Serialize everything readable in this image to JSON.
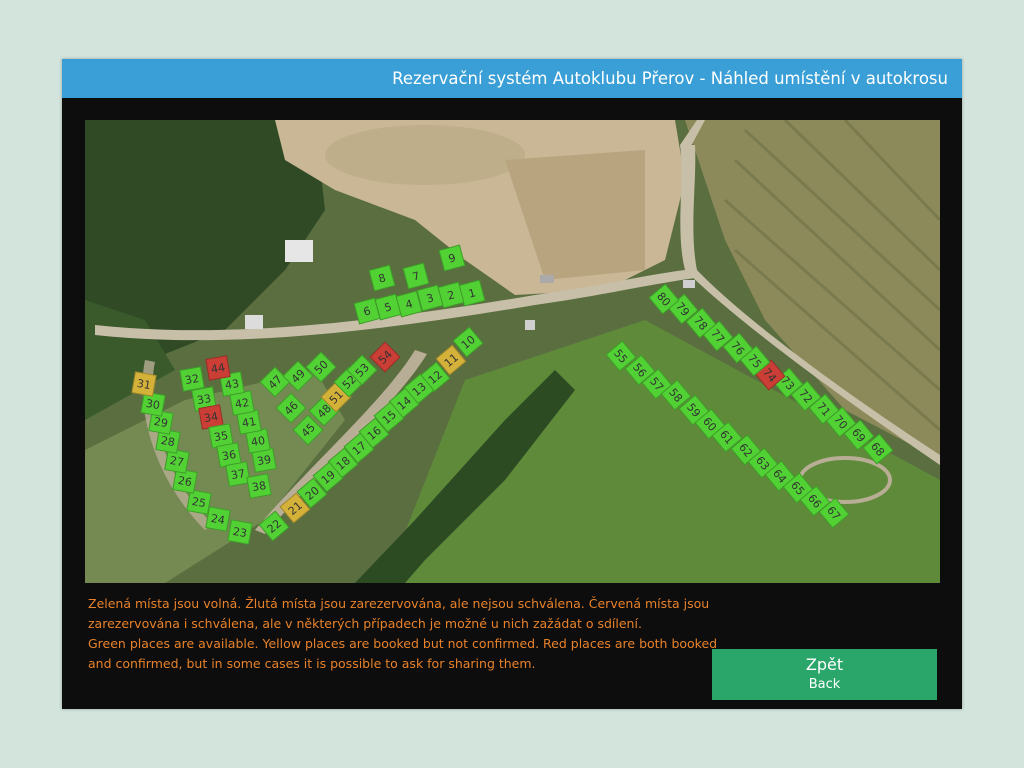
{
  "header": {
    "title": "Rezervační systém Autoklubu Přerov - Náhled umístění v autokrosu"
  },
  "legend": {
    "cs": "Zelená místa jsou volná. Žlutá místa jsou zarezervována, ale nejsou schválena. Červená místa jsou zarezervována i schválena, ale v některých případech je možné u nich zažádat o sdílení.",
    "en": "Green places are available. Yellow places are booked but not confirmed. Red places are both booked and confirmed, but in some cases it is possible to ask for sharing them."
  },
  "back_button": {
    "label_cs": "Zpět",
    "label_en": "Back"
  },
  "status_colors": {
    "free": "#52d135",
    "booked": "#d4b23a",
    "confirmed": "#cb3e35"
  },
  "spots": [
    {
      "label": "1",
      "status": "free"
    },
    {
      "label": "2",
      "status": "free"
    },
    {
      "label": "3",
      "status": "free"
    },
    {
      "label": "4",
      "status": "free"
    },
    {
      "label": "5",
      "status": "free"
    },
    {
      "label": "6",
      "status": "free"
    },
    {
      "label": "7",
      "status": "free"
    },
    {
      "label": "8",
      "status": "free"
    },
    {
      "label": "9",
      "status": "free"
    },
    {
      "label": "10",
      "status": "free"
    },
    {
      "label": "11",
      "status": "booked"
    },
    {
      "label": "12",
      "status": "free"
    },
    {
      "label": "13",
      "status": "free"
    },
    {
      "label": "14",
      "status": "free"
    },
    {
      "label": "15",
      "status": "free"
    },
    {
      "label": "16",
      "status": "free"
    },
    {
      "label": "17",
      "status": "free"
    },
    {
      "label": "18",
      "status": "free"
    },
    {
      "label": "19",
      "status": "free"
    },
    {
      "label": "20",
      "status": "free"
    },
    {
      "label": "21",
      "status": "booked"
    },
    {
      "label": "22",
      "status": "free"
    },
    {
      "label": "23",
      "status": "free"
    },
    {
      "label": "24",
      "status": "free"
    },
    {
      "label": "25",
      "status": "free"
    },
    {
      "label": "26",
      "status": "free"
    },
    {
      "label": "27",
      "status": "free"
    },
    {
      "label": "28",
      "status": "free"
    },
    {
      "label": "29",
      "status": "free"
    },
    {
      "label": "30",
      "status": "free"
    },
    {
      "label": "31",
      "status": "booked"
    },
    {
      "label": "32",
      "status": "free"
    },
    {
      "label": "33",
      "status": "free"
    },
    {
      "label": "34",
      "status": "confirmed"
    },
    {
      "label": "35",
      "status": "free"
    },
    {
      "label": "36",
      "status": "free"
    },
    {
      "label": "37",
      "status": "free"
    },
    {
      "label": "38",
      "status": "free"
    },
    {
      "label": "39",
      "status": "free"
    },
    {
      "label": "40",
      "status": "free"
    },
    {
      "label": "41",
      "status": "free"
    },
    {
      "label": "42",
      "status": "free"
    },
    {
      "label": "43",
      "status": "free"
    },
    {
      "label": "44",
      "status": "confirmed"
    },
    {
      "label": "45",
      "status": "free"
    },
    {
      "label": "46",
      "status": "free"
    },
    {
      "label": "47",
      "status": "free"
    },
    {
      "label": "48",
      "status": "free"
    },
    {
      "label": "49",
      "status": "free"
    },
    {
      "label": "50",
      "status": "free"
    },
    {
      "label": "51",
      "status": "booked"
    },
    {
      "label": "52",
      "status": "free"
    },
    {
      "label": "53",
      "status": "free"
    },
    {
      "label": "54",
      "status": "confirmed"
    },
    {
      "label": "55",
      "status": "free"
    },
    {
      "label": "56",
      "status": "free"
    },
    {
      "label": "57",
      "status": "free"
    },
    {
      "label": "58",
      "status": "free"
    },
    {
      "label": "59",
      "status": "free"
    },
    {
      "label": "60",
      "status": "free"
    },
    {
      "label": "61",
      "status": "free"
    },
    {
      "label": "62",
      "status": "free"
    },
    {
      "label": "63",
      "status": "free"
    },
    {
      "label": "64",
      "status": "free"
    },
    {
      "label": "65",
      "status": "free"
    },
    {
      "label": "66",
      "status": "free"
    },
    {
      "label": "67",
      "status": "free"
    },
    {
      "label": "68",
      "status": "free"
    },
    {
      "label": "69",
      "status": "free"
    },
    {
      "label": "70",
      "status": "free"
    },
    {
      "label": "71",
      "status": "free"
    },
    {
      "label": "72",
      "status": "free"
    },
    {
      "label": "73",
      "status": "free"
    },
    {
      "label": "74",
      "status": "confirmed"
    },
    {
      "label": "75",
      "status": "free"
    },
    {
      "label": "76",
      "status": "free"
    },
    {
      "label": "77",
      "status": "free"
    },
    {
      "label": "78",
      "status": "free"
    },
    {
      "label": "79",
      "status": "free"
    },
    {
      "label": "80",
      "status": "free"
    }
  ]
}
